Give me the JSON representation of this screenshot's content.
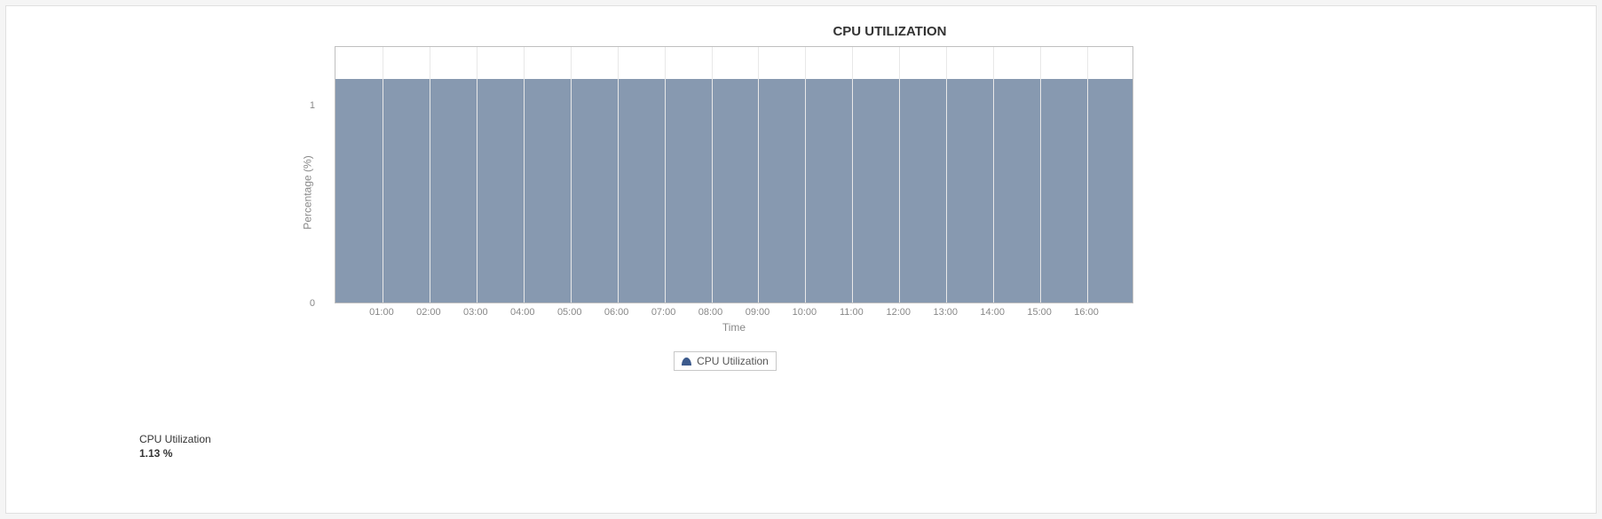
{
  "chart_data": {
    "type": "area",
    "title": "CPU UTILIZATION",
    "xlabel": "Time",
    "ylabel": "Percentage (%)",
    "ylim": [
      0,
      1.3
    ],
    "yticks": [
      0,
      1
    ],
    "x": [
      "01:00",
      "02:00",
      "03:00",
      "04:00",
      "05:00",
      "06:00",
      "07:00",
      "08:00",
      "09:00",
      "10:00",
      "11:00",
      "12:00",
      "13:00",
      "14:00",
      "15:00",
      "16:00"
    ],
    "series": [
      {
        "name": "CPU Utilization",
        "values": [
          1.13,
          1.13,
          1.13,
          1.13,
          1.13,
          1.13,
          1.13,
          1.13,
          1.13,
          1.13,
          1.13,
          1.13,
          1.13,
          1.13,
          1.13,
          1.13
        ]
      }
    ],
    "legend": {
      "position": "bottom"
    }
  },
  "stat": {
    "label": "CPU Utilization",
    "value": "1.13 %"
  },
  "colors": {
    "area_fill": "#8799b0",
    "legend_swatch": "#3c5a8c"
  }
}
